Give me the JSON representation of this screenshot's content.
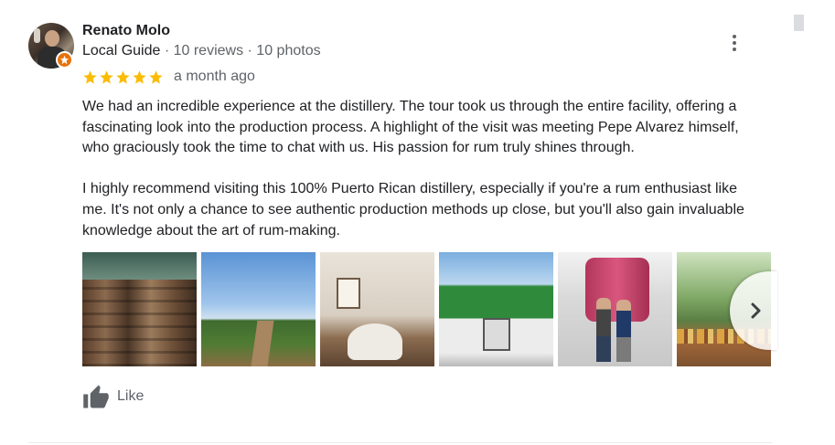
{
  "review": {
    "author_name": "Renato Molo",
    "author_badge": "Local Guide",
    "author_stats": " · 10 reviews · 10 photos",
    "rating": 5,
    "rating_max": 5,
    "date": "a month ago",
    "paragraphs": [
      "We had an incredible experience at the distillery. The tour took us through the entire facility, offering a fascinating look into the production process. A highlight of the visit was meeting Pepe Alvarez himself, who graciously took the time to chat with us. His passion for rum truly shines through.",
      "I highly recommend visiting this 100% Puerto Rican distillery, especially if you're a rum enthusiast like me. It's not only a chance to see authentic production methods up close, but you'll also gain invaluable knowledge about the art of rum-making."
    ],
    "like_label": "Like"
  },
  "colors": {
    "star": "#fbbc04",
    "guide_badge": "#e8710a",
    "text_secondary": "#5f6368"
  },
  "icons": {
    "more": "more-vert-icon",
    "like": "thumb-up-icon",
    "next": "chevron-right-icon",
    "badge": "local-guide-star-icon"
  }
}
